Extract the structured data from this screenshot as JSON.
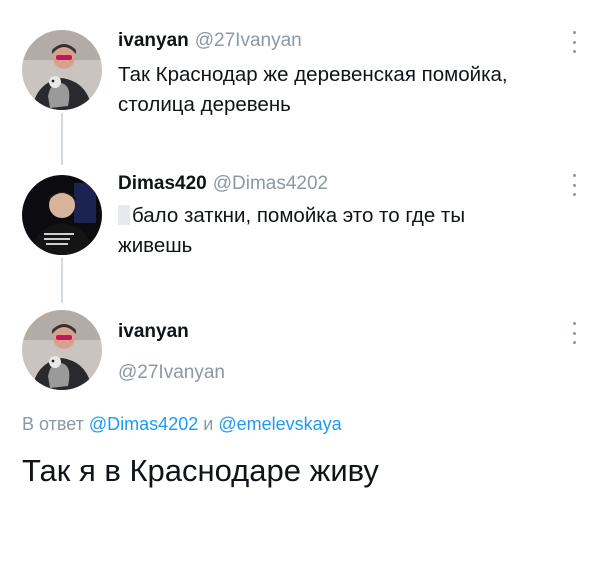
{
  "thread": [
    {
      "display_name": "ivanyan",
      "handle": "@27Ivanyan",
      "text_lines": [
        "Так Краснодар же деревенская помойка,",
        "столица деревень"
      ],
      "avatar_icon": "avatar-man-with-dog"
    },
    {
      "display_name": "Dimas420",
      "handle": "@Dimas4202",
      "text_lines": [
        "бало заткни, помойка это то где ты",
        "живешь"
      ],
      "avatar_icon": "avatar-man-dark-background"
    }
  ],
  "focus_tweet": {
    "display_name": "ivanyan",
    "handle": "@27Ivanyan",
    "reply_prefix": "В ответ",
    "reply_mention_1": "@Dimas4202",
    "reply_conjunction": "и",
    "reply_mention_2": "@emelevskaya",
    "text": "Так я в Краснодаре живу",
    "avatar_icon": "avatar-man-with-dog"
  },
  "colors": {
    "text": "#0f1419",
    "muted": "#8b98a5",
    "link": "#1d9bf0",
    "thread_line": "#cfd9de",
    "background": "#ffffff"
  }
}
